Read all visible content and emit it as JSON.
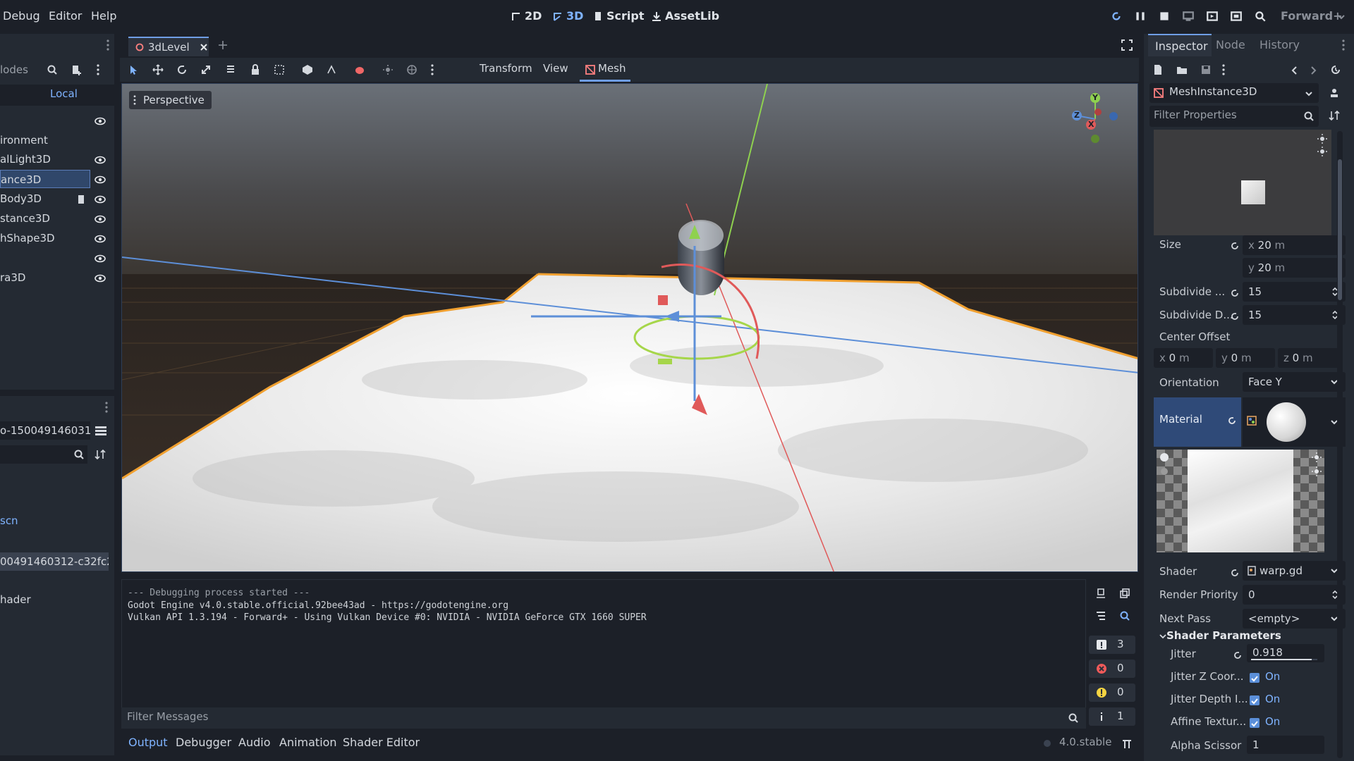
{
  "menu": {
    "items": [
      "Debug",
      "Editor",
      "Help"
    ]
  },
  "workspaces": {
    "btn_2d": "2D",
    "btn_3d": "3D",
    "btn_script": "Script",
    "btn_assetlib": "AssetLib"
  },
  "renderer": "Forward+",
  "scene_panel": {
    "search_placeholder": "lodes",
    "local_label": "Local",
    "nodes": [
      "ironment",
      "alLight3D",
      "ance3D",
      "Body3D",
      "stance3D",
      "hShape3D",
      "",
      "ra3D"
    ]
  },
  "filesystem": {
    "path_value": "o-150049146031",
    "items": [
      "scn",
      "00491460312-c32fc2...",
      "hader"
    ]
  },
  "editor_tabs": {
    "tab_name": "3dLevel"
  },
  "viewport_toolbar": {
    "transform": "Transform",
    "view": "View",
    "mesh": "Mesh"
  },
  "viewport": {
    "perspective_label": "Perspective",
    "gizmo_y": "Y",
    "gizmo_z": "Z",
    "gizmo_x": "X"
  },
  "output": {
    "lines": [
      "--- Debugging process started ---",
      "Godot Engine v4.0.stable.official.92bee43ad - https://godotengine.org",
      "Vulkan API 1.3.194 - Forward+ - Using Vulkan Device #0: NVIDIA - NVIDIA GeForce GTX 1660 SUPER"
    ],
    "filter_placeholder": "Filter Messages",
    "counts": {
      "messages": "3",
      "errors": "0",
      "warnings": "0",
      "info": "1"
    }
  },
  "bottom_tabs": [
    "Output",
    "Debugger",
    "Audio",
    "Animation",
    "Shader Editor"
  ],
  "version": "4.0.stable",
  "inspector": {
    "tabs": [
      "Inspector",
      "Node",
      "History"
    ],
    "node_type": "MeshInstance3D",
    "filter_placeholder": "Filter Properties",
    "size_label": "Size",
    "size_x": "20",
    "size_y": "20",
    "unit_m": "m",
    "subdivide_w_label": "Subdivide ...",
    "subdivide_w": "15",
    "subdivide_d_label": "Subdivide D...",
    "subdivide_d": "15",
    "center_offset_label": "Center Offset",
    "center_x": "0",
    "center_y": "0",
    "center_z": "0",
    "orientation_label": "Orientation",
    "orientation_value": "Face Y",
    "material_label": "Material",
    "shader_label": "Shader",
    "shader_value": "warp.gd",
    "render_priority_label": "Render Priority",
    "render_priority": "0",
    "next_pass_label": "Next Pass",
    "next_pass_value": "<empty>",
    "shader_params_label": "Shader Parameters",
    "jitter_label": "Jitter",
    "jitter_value": "0.918",
    "jitter_fraction": 0.918,
    "jitter_z_label": "Jitter Z Coor...",
    "jitter_depth_label": "Jitter Depth I...",
    "affine_label": "Affine Textur...",
    "on_label": "On",
    "alpha_scissor_label": "Alpha Scissor",
    "alpha_scissor_value": "1"
  },
  "colors": {
    "accent": "#7fb3ff",
    "selection": "#30476a",
    "bg": "#1c2028",
    "panel": "#242a33"
  }
}
